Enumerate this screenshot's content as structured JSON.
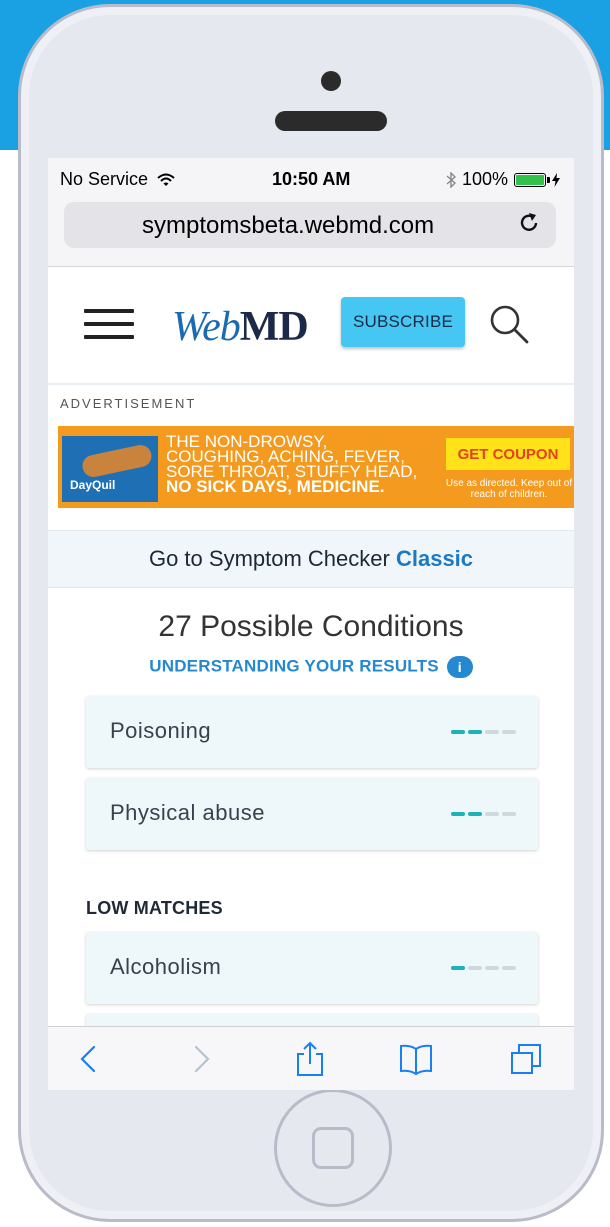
{
  "status_bar": {
    "carrier": "No Service",
    "time": "10:50 AM",
    "battery_percent": "100%",
    "battery_level": 1.0,
    "battery_color": "#31c24c"
  },
  "browser": {
    "url": "symptomsbeta.webmd.com"
  },
  "header": {
    "logo_web": "Web",
    "logo_md": "MD",
    "subscribe_label": "SUBSCRIBE"
  },
  "ad": {
    "label": "ADVERTISEMENT",
    "brand": "DayQuil",
    "line1": "THE NON-DROWSY,",
    "line2": "COUGHING, ACHING, FEVER,",
    "line3": "SORE THROAT, STUFFY HEAD,",
    "line4": "NO SICK DAYS, MEDICINE.",
    "coupon": "GET COUPON",
    "fine_print": "Use as directed. Keep out of reach of children."
  },
  "classic": {
    "prefix": "Go to Symptom Checker",
    "link": "Classic"
  },
  "results": {
    "title": "27 Possible Conditions",
    "understanding": "UNDERSTANDING YOUR RESULTS",
    "info_glyph": "i",
    "conditions": [
      {
        "name": "Poisoning",
        "match_level": 2,
        "match_max": 4
      },
      {
        "name": "Physical abuse",
        "match_level": 2,
        "match_max": 4
      }
    ],
    "low_heading": "LOW MATCHES",
    "low_conditions": [
      {
        "name": "Alcoholism",
        "match_level": 1,
        "match_max": 4
      }
    ]
  },
  "colors": {
    "accent_blue": "#2589d2",
    "subscribe_bg": "#46c6f3",
    "meter_on": "#1ab4b8",
    "page_bg_blue": "#1aa1e3"
  }
}
